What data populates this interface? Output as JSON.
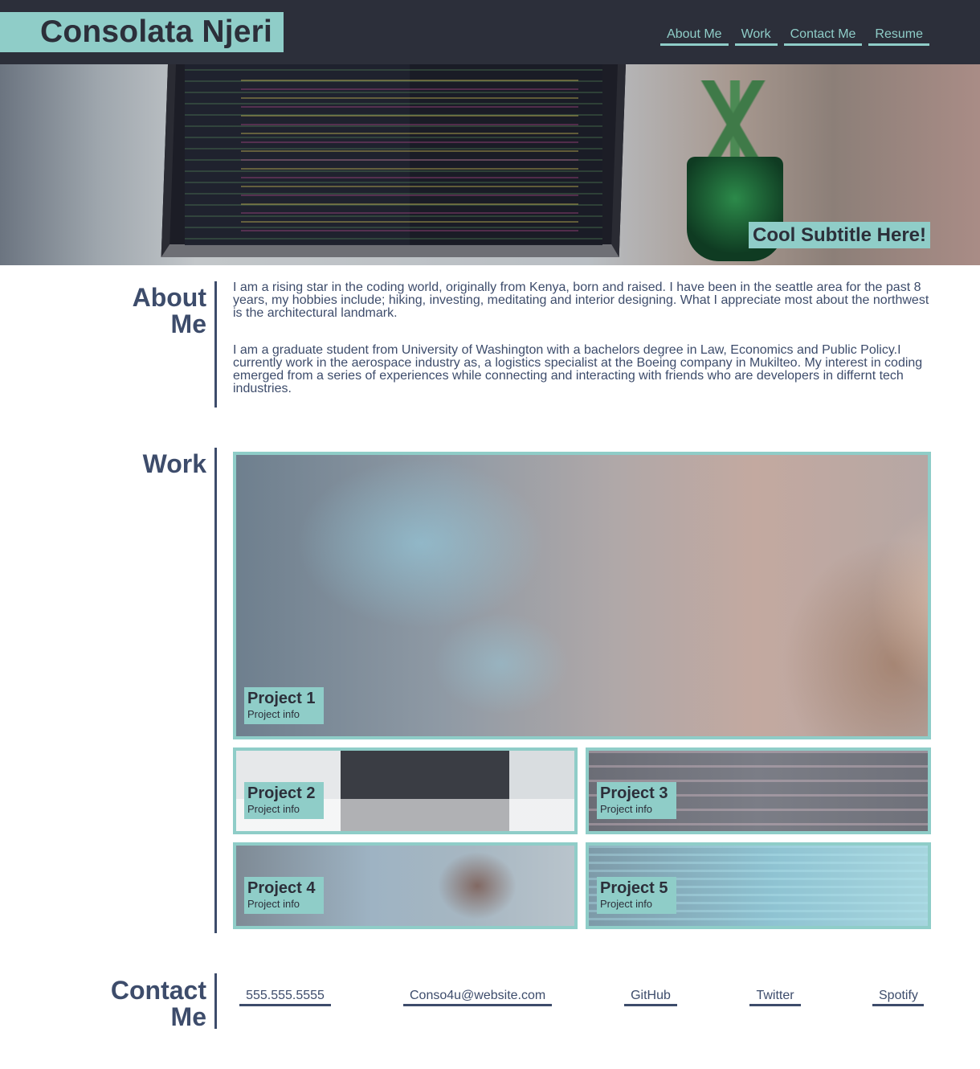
{
  "header": {
    "name": "Consolata Njeri",
    "nav": [
      {
        "label": "About Me"
      },
      {
        "label": "Work"
      },
      {
        "label": "Contact Me"
      },
      {
        "label": "Resume"
      }
    ]
  },
  "hero": {
    "subtitle": "Cool Subtitle Here!"
  },
  "about": {
    "title_line1": "About",
    "title_line2": "Me",
    "paragraph1": "I am a rising star in the coding world, originally from Kenya, born and raised. I have been in the seattle area for the past 8 years, my hobbies include; hiking, investing, meditating and interior designing. What I appreciate most about the northwest is the architectural landmark.",
    "paragraph2": "I am a graduate student from University of Washington with a bachelors degree in Law, Economics and Public Policy.I currently work in the aerospace industry as, a logistics specialist at the Boeing company in Mukilteo. My interest in coding emerged from a series of experiences while connecting and interacting with friends who are developers in differnt tech industries."
  },
  "work": {
    "title": "Work",
    "projects": [
      {
        "title": "Project 1",
        "info": "Project info"
      },
      {
        "title": "Project 2",
        "info": "Project info"
      },
      {
        "title": "Project 3",
        "info": "Project info"
      },
      {
        "title": "Project 4",
        "info": "Project info"
      },
      {
        "title": "Project 5",
        "info": "Project info"
      }
    ]
  },
  "contact": {
    "title_line1": "Contact",
    "title_line2": "Me",
    "links": [
      {
        "label": "555.555.5555"
      },
      {
        "label": "Conso4u@website.com"
      },
      {
        "label": "GitHub"
      },
      {
        "label": "Twitter"
      },
      {
        "label": "Spotify"
      }
    ]
  },
  "colors": {
    "header_bg": "#2c2f3a",
    "accent": "#8fcdc8",
    "text": "#3d4c6b"
  }
}
